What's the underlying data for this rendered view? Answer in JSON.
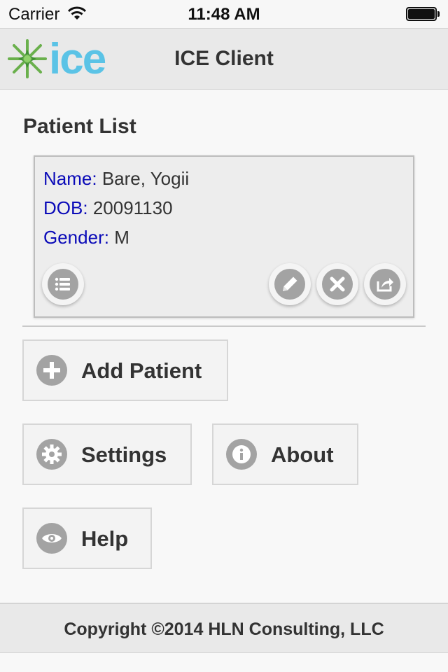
{
  "status_bar": {
    "carrier": "Carrier",
    "time": "11:48 AM"
  },
  "header": {
    "logo_text": "ice",
    "title": "ICE Client"
  },
  "patient_list": {
    "title": "Patient List",
    "patients": [
      {
        "name_label": "Name:",
        "name": "Bare, Yogii",
        "dob_label": "DOB:",
        "dob": "20091130",
        "gender_label": "Gender:",
        "gender": "M",
        "actions": [
          "list-icon",
          "pencil-icon",
          "close-icon",
          "share-icon"
        ]
      }
    ]
  },
  "buttons": {
    "add_patient": "Add Patient",
    "settings": "Settings",
    "about": "About",
    "help": "Help"
  },
  "footer": {
    "copyright": "Copyright ©2014 HLN Consulting, LLC"
  },
  "colors": {
    "label_blue": "#0a0ab8",
    "logo_blue": "#5bc3e6",
    "logo_green": "#6ab04c",
    "icon_gray": "#a3a3a3"
  }
}
